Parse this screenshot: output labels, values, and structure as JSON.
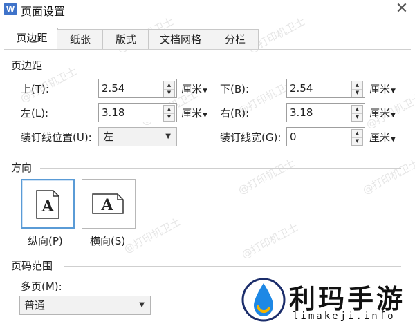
{
  "window": {
    "title": "页面设置",
    "app_icon": "W"
  },
  "tabs": [
    {
      "label": "页边距",
      "active": true
    },
    {
      "label": "纸张"
    },
    {
      "label": "版式"
    },
    {
      "label": "文档网格"
    },
    {
      "label": "分栏"
    }
  ],
  "margins": {
    "section_title": "页边距",
    "top": {
      "label": "上(T):",
      "value": "2.54",
      "unit": "厘米"
    },
    "bottom": {
      "label": "下(B):",
      "value": "2.54",
      "unit": "厘米"
    },
    "left": {
      "label": "左(L):",
      "value": "3.18",
      "unit": "厘米"
    },
    "right": {
      "label": "右(R):",
      "value": "3.18",
      "unit": "厘米"
    },
    "gutter_pos": {
      "label": "装订线位置(U):",
      "value": "左"
    },
    "gutter_width": {
      "label": "装订线宽(G):",
      "value": "0",
      "unit": "厘米"
    }
  },
  "orientation": {
    "section_title": "方向",
    "portrait": {
      "label": "纵向(P)",
      "glyph": "A",
      "selected": true
    },
    "landscape": {
      "label": "横向(S)",
      "glyph": "A"
    }
  },
  "page_range": {
    "section_title": "页码范围",
    "multi_label": "多页(M):",
    "multi_value": "普通"
  },
  "watermark_text": "@打印机卫士",
  "brand": {
    "name": "利玛手游",
    "url": "limakeji.info"
  },
  "colors": {
    "accent": "#5a9bd6",
    "icon_blue": "#3f73c9"
  }
}
